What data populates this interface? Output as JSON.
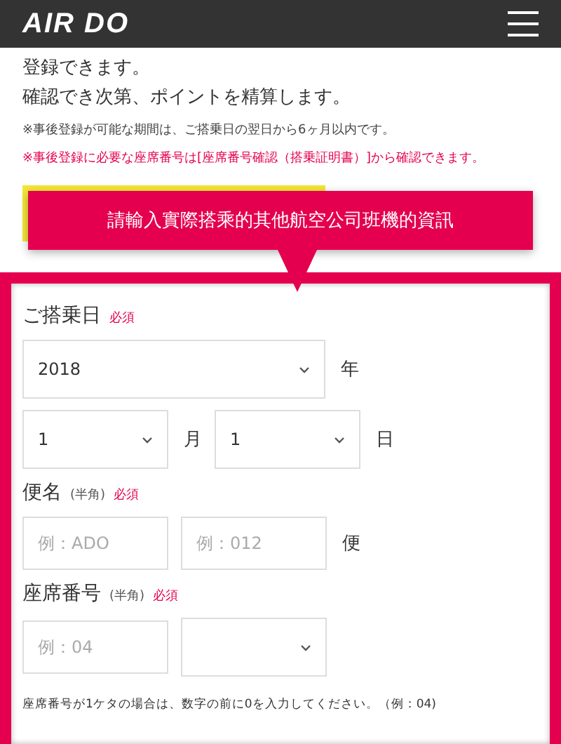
{
  "header": {
    "logo": "AIR DO"
  },
  "intro": [
    "登録できます。",
    "確認でき次第、ポイントを精算します。"
  ],
  "notes": [
    {
      "text": "※事後登録が可能な期間は、ご搭乗日の翌日から6ヶ月以内です。",
      "kind": "plain"
    },
    {
      "text": "※事後登録に必要な座席番号は[座席番号確認（搭乗証明書）]から確認できます。",
      "kind": "alert"
    }
  ],
  "callout": "請輸入實際搭乘的其他航空公司班機的資訊",
  "form": {
    "sections": [
      {
        "label": "ご搭乗日",
        "required": "必須",
        "rows": [
          [
            {
              "kind": "select",
              "value": "2018"
            },
            {
              "kind": "unit",
              "text": "年"
            }
          ],
          [
            {
              "kind": "select",
              "value": "1"
            },
            {
              "kind": "unit",
              "text": "月"
            },
            {
              "kind": "select",
              "value": "1"
            },
            {
              "kind": "unit",
              "text": "日"
            }
          ]
        ]
      },
      {
        "label": "便名",
        "hint": "(半角)",
        "required": "必須",
        "rows": [
          [
            {
              "kind": "input",
              "placeholder": "例：ADO"
            },
            {
              "kind": "input",
              "placeholder": "例：012"
            },
            {
              "kind": "unit",
              "text": "便"
            }
          ]
        ]
      },
      {
        "label": "座席番号",
        "hint": "(半角)",
        "required": "必須",
        "rows": [
          [
            {
              "kind": "input",
              "placeholder": "例：04"
            },
            {
              "kind": "select"
            }
          ]
        ]
      }
    ],
    "footnote": "座席番号が1ケタの場合は、数字の前に0を入力してください。（例：04)"
  }
}
